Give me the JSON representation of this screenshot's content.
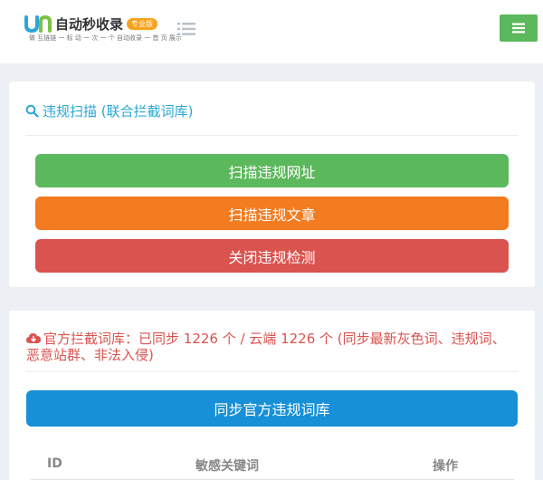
{
  "header": {
    "logo_text": "自动秒收录",
    "logo_badge": "专业版",
    "logo_slogan": "做 互链链 一 标 动 一 次 一 个 自动收录 一 首 页 展示"
  },
  "scan_panel": {
    "title": "违规扫描 (联合拦截词库)",
    "buttons": {
      "scan_urls": "扫描违规网址",
      "scan_articles": "扫描违规文章",
      "close_detection": "关闭违规检测"
    }
  },
  "library_panel": {
    "status": "官方拦截词库：已同步 1226 个 / 云端 1226 个 (同步最新灰色词、违规词、恶意站群、非法入侵)",
    "sync_button": "同步官方违规词库",
    "table": {
      "columns": [
        "ID",
        "敏感关键词",
        "操作"
      ]
    }
  },
  "colors": {
    "green": "#5cb85c",
    "orange": "#f37b20",
    "red": "#d9534f",
    "blue": "#1790d8",
    "teal": "#29a7d4"
  }
}
